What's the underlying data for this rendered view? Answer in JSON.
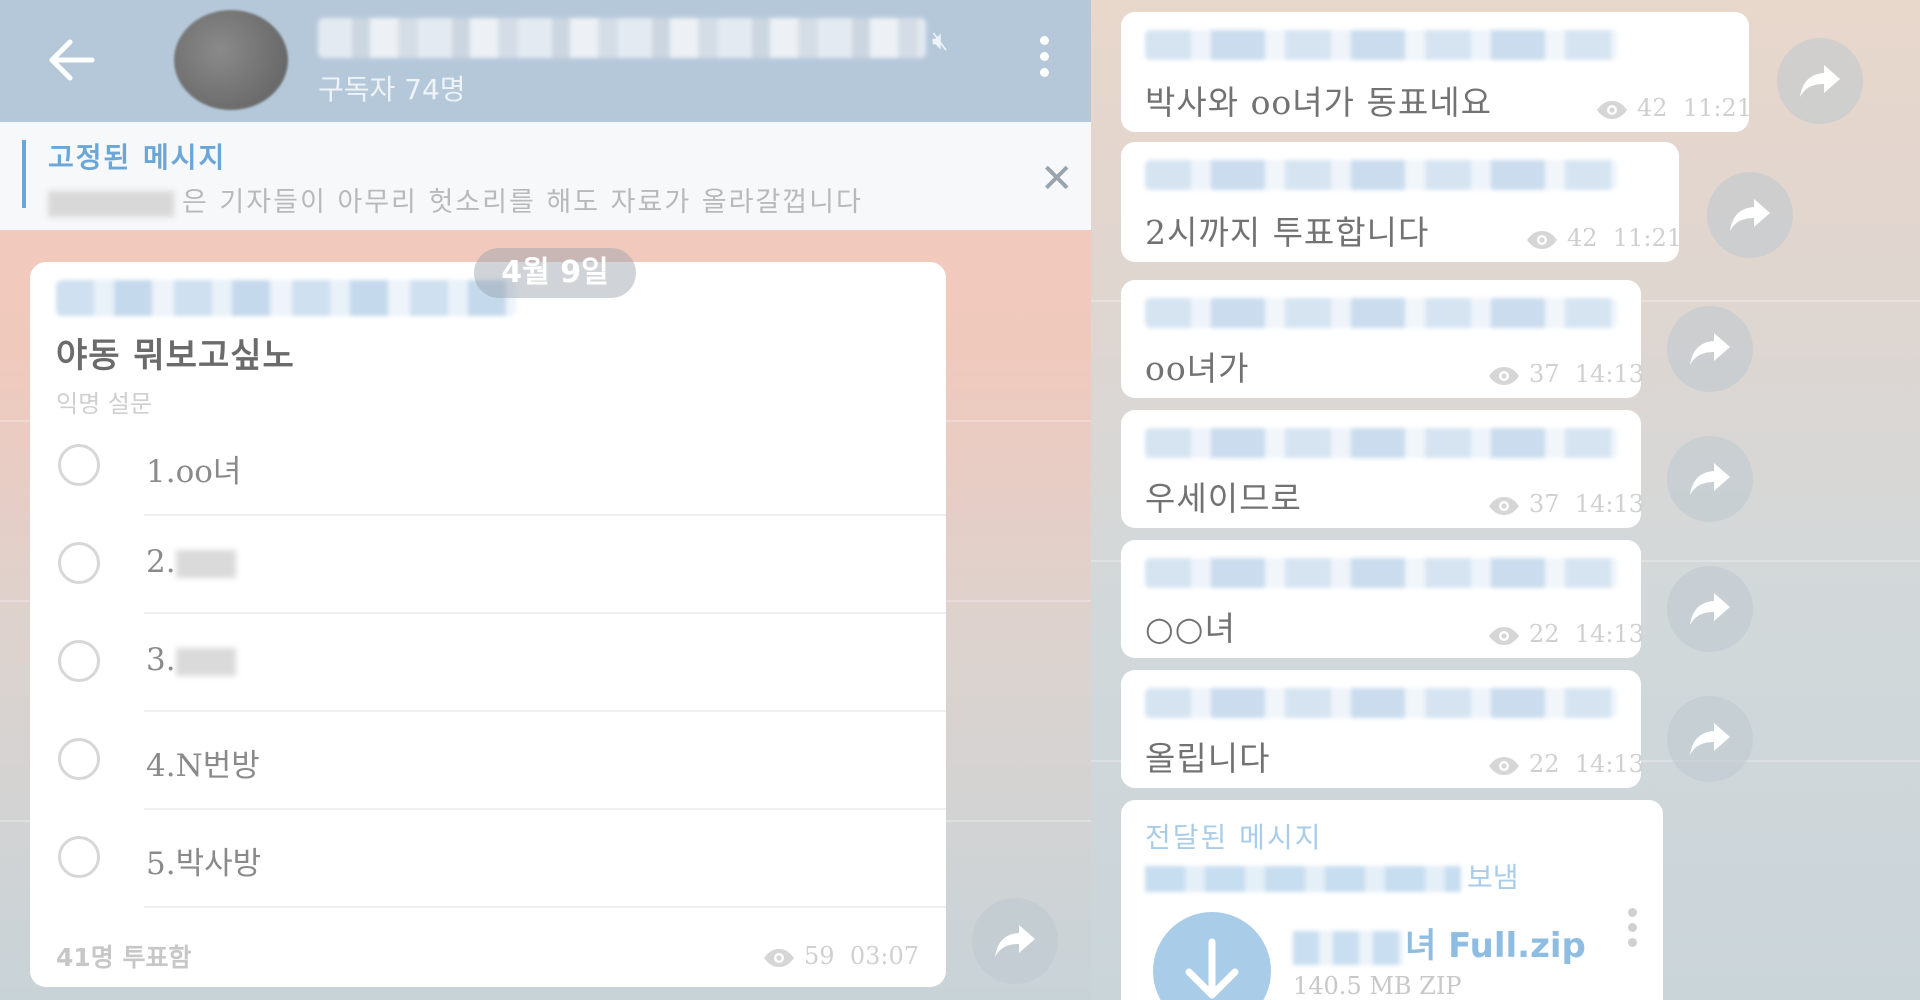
{
  "header": {
    "subscribers": "구독자 74명"
  },
  "pinned": {
    "title": "고정된 메시지",
    "text": "은 기자들이 아무리 헛소리를 해도 자료가 올라갈껍니다"
  },
  "date_pill": "4월 9일",
  "poll": {
    "question": "야동 뭐보고싶노",
    "type": "익명 설문",
    "options": [
      "1.oo녀",
      "2.",
      "3.",
      "4.N번방",
      "5.박사방"
    ],
    "votes": "41명 투표함",
    "views": "59",
    "time": "03:07"
  },
  "messages": [
    {
      "text": "박사와 oo녀가 동표네요",
      "views": "42",
      "time": "11:21"
    },
    {
      "text": "2시까지 투표합니다",
      "views": "42",
      "time": "11:21"
    },
    {
      "text": "oo녀가",
      "views": "37",
      "time": "14:13"
    },
    {
      "text": "우세이므로",
      "views": "37",
      "time": "14:13"
    },
    {
      "text": "○○녀",
      "views": "22",
      "time": "14:13"
    },
    {
      "text": "올립니다",
      "views": "22",
      "time": "14:13"
    }
  ],
  "forwarded": {
    "label": "전달된 메시지",
    "from_suffix": "보냄",
    "file_name": "녀 Full.zip",
    "file_size": "140.5 MB ZIP"
  },
  "colors": {
    "header_bg": "#b5c8da",
    "accent": "#6aa6d8",
    "file_accent": "#a9cde9"
  }
}
